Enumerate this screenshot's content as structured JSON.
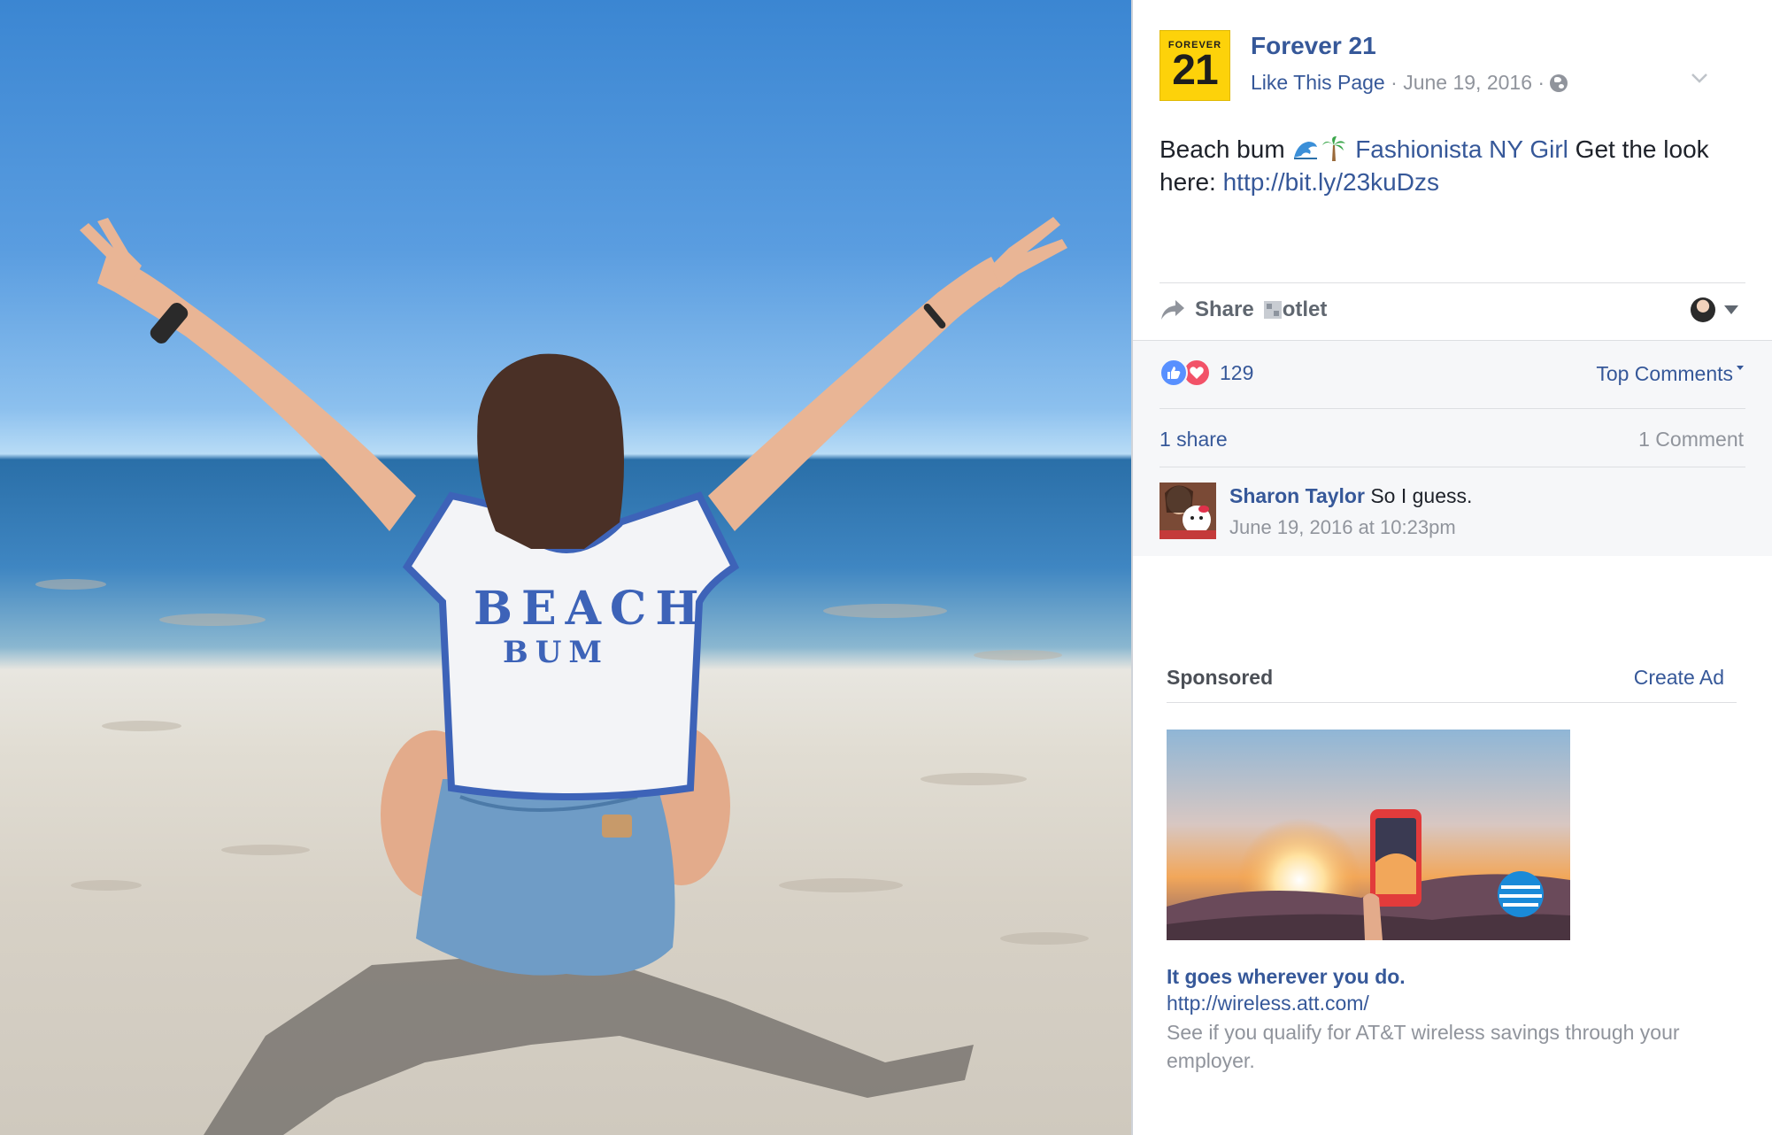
{
  "photo": {
    "shirt_text_line1": "BEACH",
    "shirt_text_line2": "BUM"
  },
  "post": {
    "logo_small": "FOREVER",
    "logo_big": "21",
    "page_name": "Forever 21",
    "like_link": "Like This Page",
    "meta_sep": " · ",
    "date": "June 19, 2016",
    "caption_start": "Beach bum ",
    "caption_emojis": "wave-emoji, palm-tree-emoji",
    "tagged_page": "Fashionista NY Girl",
    "caption_mid": " Get the look here: ",
    "caption_link": "http://bit.ly/23kuDzs"
  },
  "actions": {
    "share_label": "Share",
    "share_suffix": "otlet",
    "icon": "share-arrow-icon"
  },
  "feedback": {
    "reaction_icons": [
      "like-reaction-icon",
      "love-reaction-icon"
    ],
    "reaction_count": "129",
    "sort_label": "Top Comments",
    "shares": "1 share",
    "comment_count": "1 Comment"
  },
  "comments": [
    {
      "author": "Sharon Taylor",
      "text": "So I guess.",
      "time": "June 19, 2016 at 10:23pm"
    }
  ],
  "ads": {
    "heading": "Sponsored",
    "create_ad": "Create Ad",
    "title": "It goes wherever you do.",
    "url": "http://wireless.att.com/",
    "description": "See if you qualify for AT&T wireless savings through your employer."
  },
  "colors": {
    "link": "#365899",
    "meta": "#90949c",
    "text": "#1d2129",
    "feedback_bg": "#f6f7f9",
    "logo_yellow": "#fdd20a",
    "like_blue": "#5890ff",
    "love_red": "#f25268"
  }
}
